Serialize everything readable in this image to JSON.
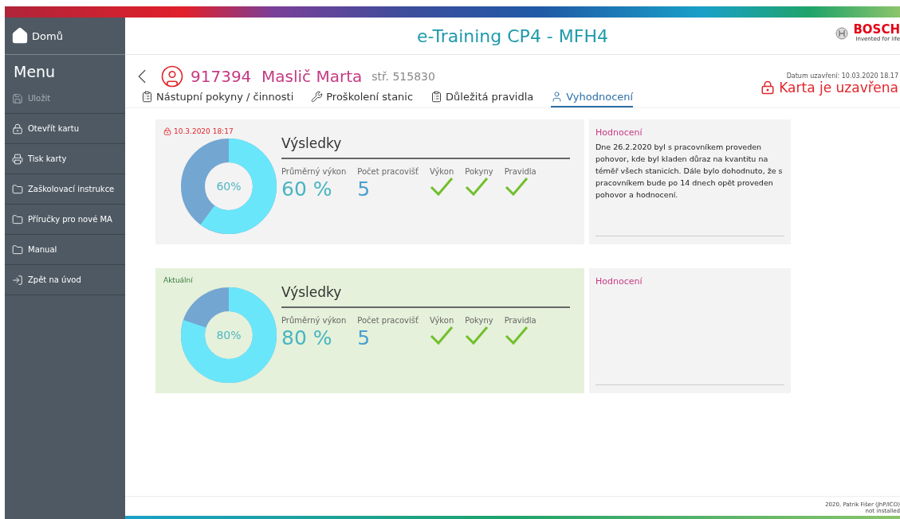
{
  "sidebar": {
    "home": "Domů",
    "menu_title": "Menu",
    "items": [
      {
        "label": "Uložit",
        "disabled": true
      },
      {
        "label": "Otevřít kartu",
        "disabled": false
      },
      {
        "label": "Tisk karty",
        "disabled": false
      },
      {
        "label": "Zaškolovací instrukce",
        "disabled": false
      },
      {
        "label": "Příručky pro nové MA",
        "disabled": false
      },
      {
        "label": "Manual",
        "disabled": false
      },
      {
        "label": "Zpět na úvod",
        "disabled": false
      }
    ]
  },
  "header": {
    "title": "e-Training CP4 - MFH4",
    "logo": "BOSCH",
    "tagline": "Invented for life"
  },
  "person": {
    "id": "917394",
    "name": "Maslič Marta",
    "center": "stř. 515830"
  },
  "status": {
    "closed_date": "Datum uzavření: 10.03.2020 18.17",
    "closed": true,
    "label": "Karta je uzavřena"
  },
  "tabs": [
    {
      "label": "Nástupní pokyny / činnosti",
      "selected": false
    },
    {
      "label": "Proškolení stanic",
      "selected": false
    },
    {
      "label": "Důležitá pravidla",
      "selected": false
    },
    {
      "label": "Vyhodnocení",
      "selected": true
    }
  ],
  "results": [
    {
      "tag": "10.3.2020 18:17",
      "locked": true,
      "current": false,
      "level": 0.6,
      "percent": "60%",
      "title": "Výsledky",
      "avg_label": "Průměrný výkon",
      "avg_value": "60 %",
      "count_label": "Počet pracovišť",
      "count_value": "5",
      "checks": [
        {
          "label": "Výkon",
          "passed": true
        },
        {
          "label": "Pokyny",
          "passed": true
        },
        {
          "label": "Pravidla",
          "passed": true
        }
      ],
      "review_title": "Hodnocení",
      "review_text": "Dne 26.2.2020 byl s pracovníkem proveden pohovor, kde byl kladen důraz na kvantitu na téměř všech stanicích. Dále bylo dohodnuto, že s pracovníkem bude po 14 dnech opět proveden pohovor a hodnocení."
    },
    {
      "tag": "Aktuální",
      "locked": false,
      "current": true,
      "level": 0.8,
      "percent": "80%",
      "title": "Výsledky",
      "avg_label": "Průměrný výkon",
      "avg_value": "80 %",
      "count_label": "Počet pracovišť",
      "count_value": "5",
      "checks": [
        {
          "label": "Výkon",
          "passed": true
        },
        {
          "label": "Pokyny",
          "passed": true
        },
        {
          "label": "Pravidla",
          "passed": true
        }
      ],
      "review_title": "Hodnocení"
    }
  ],
  "footer": {
    "credit": "2020, Patrik Fišer (JhP/ICO)",
    "note": "not installed"
  }
}
